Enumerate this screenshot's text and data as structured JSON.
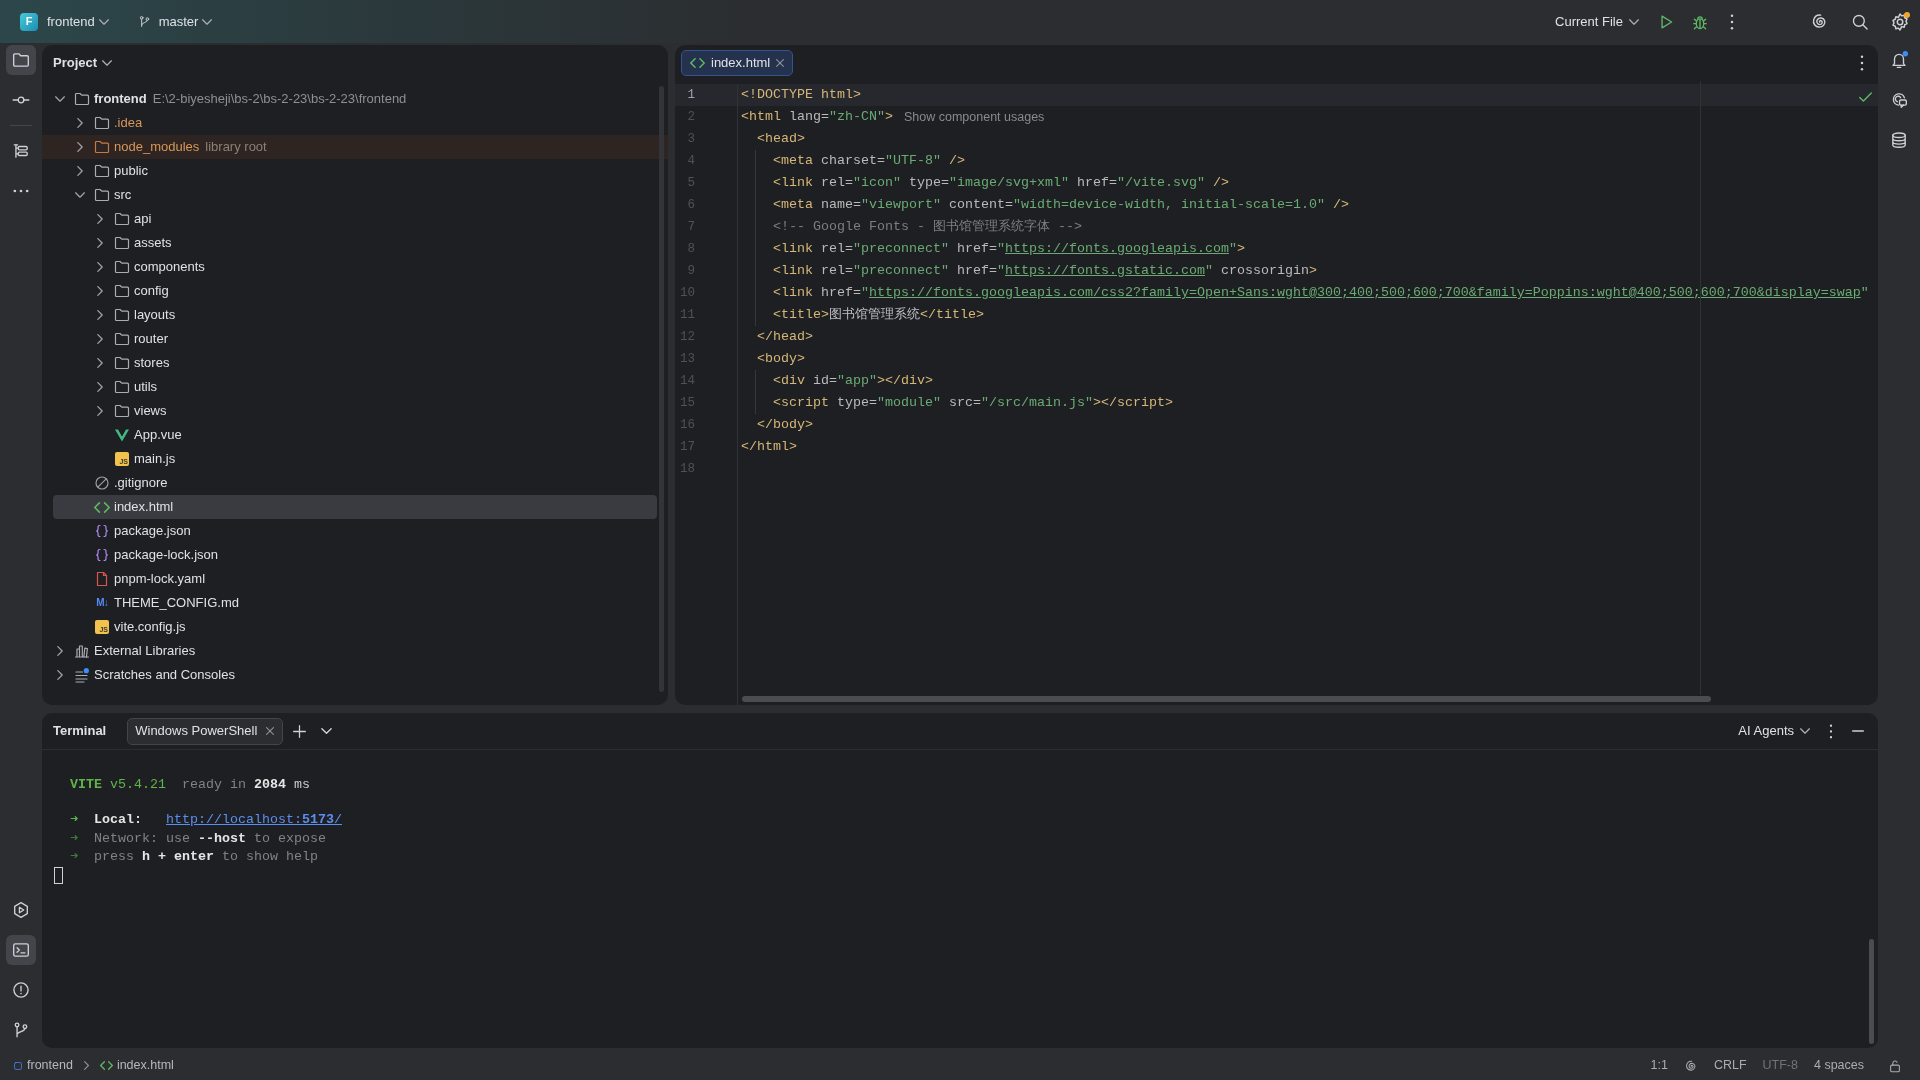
{
  "title_bar": {
    "project": {
      "initial": "F",
      "name": "frontend"
    },
    "branch": "master",
    "run_config": "Current File",
    "run_actions": [
      {
        "kind": "run"
      },
      {
        "kind": "debug"
      },
      {
        "kind": "more"
      }
    ],
    "actions": [
      {
        "kind": "ai",
        "badge": false
      },
      {
        "kind": "search",
        "badge": false
      },
      {
        "kind": "settings",
        "badge": true
      }
    ]
  },
  "left_toolbar": {
    "top_groups": [
      {
        "items": [
          {
            "kind": "project",
            "selected": true
          },
          {
            "kind": "commit",
            "selected": false
          }
        ]
      },
      {
        "items": [
          {
            "kind": "structure",
            "selected": false
          },
          {
            "kind": "more",
            "selected": false
          }
        ]
      }
    ],
    "bottom": [
      {
        "kind": "run",
        "selected": false
      },
      {
        "kind": "terminal",
        "selected": true
      },
      {
        "kind": "problems",
        "selected": false
      },
      {
        "kind": "git",
        "selected": false
      }
    ]
  },
  "right_toolbar": [
    {
      "kind": "notifications",
      "badge": true
    },
    {
      "kind": "ai_chat",
      "badge": false
    },
    {
      "kind": "database",
      "badge": false
    }
  ],
  "project_panel": {
    "title": "Project",
    "tree": [
      {
        "name": "frontend",
        "kind": "root",
        "hint": "E:\\2-biyesheji\\bs-2\\bs-2-23\\bs-2-23\\frontend",
        "expanded": true,
        "selected": false,
        "ignored": false,
        "children": [
          {
            "name": ".idea",
            "kind": "folder",
            "expanded": false,
            "selected": false,
            "ignored": true
          },
          {
            "name": "node_modules",
            "kind": "library",
            "hint": "library root",
            "expanded": false,
            "selected": false,
            "ignored": true
          },
          {
            "name": "public",
            "kind": "folder",
            "expanded": false,
            "selected": false,
            "ignored": false
          },
          {
            "name": "src",
            "kind": "folder",
            "expanded": true,
            "selected": false,
            "ignored": false,
            "children": [
              {
                "name": "api",
                "kind": "folder",
                "expanded": false,
                "selected": false,
                "ignored": false
              },
              {
                "name": "assets",
                "kind": "folder",
                "expanded": false,
                "selected": false,
                "ignored": false
              },
              {
                "name": "components",
                "kind": "folder",
                "expanded": false,
                "selected": false,
                "ignored": false
              },
              {
                "name": "config",
                "kind": "folder",
                "expanded": false,
                "selected": false,
                "ignored": false
              },
              {
                "name": "layouts",
                "kind": "folder",
                "expanded": false,
                "selected": false,
                "ignored": false
              },
              {
                "name": "router",
                "kind": "folder",
                "expanded": false,
                "selected": false,
                "ignored": false
              },
              {
                "name": "stores",
                "kind": "folder",
                "expanded": false,
                "selected": false,
                "ignored": false
              },
              {
                "name": "utils",
                "kind": "folder",
                "expanded": false,
                "selected": false,
                "ignored": false
              },
              {
                "name": "views",
                "kind": "folder",
                "expanded": false,
                "selected": false,
                "ignored": false
              },
              {
                "name": "App.vue",
                "kind": "vue",
                "selected": false,
                "ignored": false
              },
              {
                "name": "main.js",
                "kind": "js",
                "badge": "JS",
                "selected": false,
                "ignored": false
              }
            ]
          },
          {
            "name": ".gitignore",
            "kind": "ignore",
            "selected": false,
            "ignored": false
          },
          {
            "name": "index.html",
            "kind": "html",
            "selected": true,
            "ignored": false
          },
          {
            "name": "package.json",
            "kind": "json",
            "selected": false,
            "ignored": false
          },
          {
            "name": "package-lock.json",
            "kind": "json",
            "selected": false,
            "ignored": false
          },
          {
            "name": "pnpm-lock.yaml",
            "kind": "yaml",
            "selected": false,
            "ignored": false
          },
          {
            "name": "THEME_CONFIG.md",
            "kind": "markdown",
            "badge": "M↓",
            "selected": false,
            "ignored": false
          },
          {
            "name": "vite.config.js",
            "kind": "js",
            "badge": "JS",
            "selected": false,
            "ignored": false
          }
        ]
      },
      {
        "name": "External Libraries",
        "kind": "libraries",
        "expanded": false,
        "selected": false,
        "ignored": false
      },
      {
        "name": "Scratches and Consoles",
        "kind": "scratches",
        "expanded": false,
        "selected": false,
        "ignored": false
      }
    ]
  },
  "editor": {
    "tabs": [
      {
        "label": "index.html",
        "selected": true
      }
    ],
    "lines": [
      {
        "number": "1",
        "current": true,
        "tokens": [
          {
            "kind": "doctype",
            "text": "<!DOCTYPE html>"
          }
        ]
      },
      {
        "number": "2",
        "current": false,
        "tokens": [
          {
            "kind": "tag",
            "text": "<html"
          },
          {
            "kind": "attr",
            "text": " lang="
          },
          {
            "kind": "value",
            "text": "\"zh-CN\""
          },
          {
            "kind": "tag",
            "text": ">"
          }
        ],
        "hint": "Show component usages",
        "children": [
          {
            "number": "3",
            "current": false,
            "tokens": [
              {
                "kind": "tag",
                "text": "<head>"
              }
            ],
            "children": [
              {
                "number": "4",
                "current": false,
                "tokens": [
                  {
                    "kind": "tag",
                    "text": "<meta"
                  },
                  {
                    "kind": "attr",
                    "text": " charset="
                  },
                  {
                    "kind": "value",
                    "text": "\"UTF-8\""
                  },
                  {
                    "kind": "tag",
                    "text": " />"
                  }
                ]
              },
              {
                "number": "5",
                "current": false,
                "tokens": [
                  {
                    "kind": "tag",
                    "text": "<link"
                  },
                  {
                    "kind": "attr",
                    "text": " rel="
                  },
                  {
                    "kind": "value",
                    "text": "\"icon\""
                  },
                  {
                    "kind": "attr",
                    "text": " type="
                  },
                  {
                    "kind": "value",
                    "text": "\"image/svg+xml\""
                  },
                  {
                    "kind": "attr",
                    "text": " href="
                  },
                  {
                    "kind": "value",
                    "text": "\"/vite.svg\""
                  },
                  {
                    "kind": "tag",
                    "text": " />"
                  }
                ]
              },
              {
                "number": "6",
                "current": false,
                "tokens": [
                  {
                    "kind": "tag",
                    "text": "<meta"
                  },
                  {
                    "kind": "attr",
                    "text": " name="
                  },
                  {
                    "kind": "value",
                    "text": "\"viewport\""
                  },
                  {
                    "kind": "attr",
                    "text": " content="
                  },
                  {
                    "kind": "value",
                    "text": "\"width=device-width, initial-scale=1.0\""
                  },
                  {
                    "kind": "tag",
                    "text": " />"
                  }
                ]
              },
              {
                "number": "7",
                "current": false,
                "tokens": [
                  {
                    "kind": "comment",
                    "text": "<!-- Google Fonts - 图书馆管理系统字体 -->"
                  }
                ]
              },
              {
                "number": "8",
                "current": false,
                "tokens": [
                  {
                    "kind": "tag",
                    "text": "<link"
                  },
                  {
                    "kind": "attr",
                    "text": " rel="
                  },
                  {
                    "kind": "value",
                    "text": "\"preconnect\""
                  },
                  {
                    "kind": "attr",
                    "text": " href="
                  },
                  {
                    "kind": "value",
                    "text": "\""
                  },
                  {
                    "kind": "link",
                    "text": "https://fonts.googleapis.com"
                  },
                  {
                    "kind": "value",
                    "text": "\""
                  },
                  {
                    "kind": "tag",
                    "text": ">"
                  }
                ]
              },
              {
                "number": "9",
                "current": false,
                "tokens": [
                  {
                    "kind": "tag",
                    "text": "<link"
                  },
                  {
                    "kind": "attr",
                    "text": " rel="
                  },
                  {
                    "kind": "value",
                    "text": "\"preconnect\""
                  },
                  {
                    "kind": "attr",
                    "text": " href="
                  },
                  {
                    "kind": "value",
                    "text": "\""
                  },
                  {
                    "kind": "link",
                    "text": "https://fonts.gstatic.com"
                  },
                  {
                    "kind": "value",
                    "text": "\""
                  },
                  {
                    "kind": "attr",
                    "text": " crossorigin"
                  },
                  {
                    "kind": "tag",
                    "text": ">"
                  }
                ]
              },
              {
                "number": "10",
                "current": false,
                "tokens": [
                  {
                    "kind": "tag",
                    "text": "<link"
                  },
                  {
                    "kind": "attr",
                    "text": " href="
                  },
                  {
                    "kind": "value",
                    "text": "\""
                  },
                  {
                    "kind": "link",
                    "text": "https://fonts.googleapis.com/css2?family=Open+Sans:wght@300;400;500;600;700&family=Poppins:wght@400;500;600;700&display=swap"
                  },
                  {
                    "kind": "value",
                    "text": "\""
                  }
                ]
              },
              {
                "number": "11",
                "current": false,
                "tokens": [
                  {
                    "kind": "tag",
                    "text": "<title>"
                  },
                  {
                    "kind": "text",
                    "text": "图书馆管理系统"
                  },
                  {
                    "kind": "tag",
                    "text": "</title>"
                  }
                ]
              }
            ]
          },
          {
            "number": "12",
            "current": false,
            "tokens": [
              {
                "kind": "tag",
                "text": "</head>"
              }
            ]
          },
          {
            "number": "13",
            "current": false,
            "tokens": [
              {
                "kind": "tag",
                "text": "<body>"
              }
            ],
            "children": [
              {
                "number": "14",
                "current": false,
                "tokens": [
                  {
                    "kind": "tag",
                    "text": "<div"
                  },
                  {
                    "kind": "attr",
                    "text": " id="
                  },
                  {
                    "kind": "value",
                    "text": "\"app\""
                  },
                  {
                    "kind": "tag",
                    "text": "></div>"
                  }
                ]
              },
              {
                "number": "15",
                "current": false,
                "tokens": [
                  {
                    "kind": "tag",
                    "text": "<script"
                  },
                  {
                    "kind": "attr",
                    "text": " type="
                  },
                  {
                    "kind": "value",
                    "text": "\"module\""
                  },
                  {
                    "kind": "attr",
                    "text": " src="
                  },
                  {
                    "kind": "value",
                    "text": "\"/src/main.js\""
                  },
                  {
                    "kind": "tag",
                    "text": "></script>"
                  }
                ]
              }
            ]
          },
          {
            "number": "16",
            "current": false,
            "tokens": [
              {
                "kind": "tag",
                "text": "</body>"
              }
            ]
          }
        ]
      },
      {
        "number": "17",
        "current": false,
        "tokens": [
          {
            "kind": "tag",
            "text": "</html>"
          }
        ]
      },
      {
        "number": "18",
        "current": false
      }
    ]
  },
  "terminal": {
    "title": "Terminal",
    "tabs": [
      {
        "label": "Windows PowerShell",
        "selected": true
      }
    ],
    "agents": "AI Agents",
    "blocks": [
      {
        "lines": [
          {
            "tokens": [
              {
                "kind": "brand",
                "text": "VITE"
              },
              {
                "kind": "version",
                "text": " v5.4.21"
              },
              {
                "kind": "dim",
                "text": "  ready in "
              },
              {
                "kind": "bold",
                "text": "2084"
              },
              {
                "kind": "plain",
                "text": " ms"
              }
            ]
          }
        ]
      },
      {
        "lines": [
          {
            "tokens": [
              {
                "kind": "arrow",
                "text": "➜"
              },
              {
                "kind": "label",
                "text": "  Local:   "
              },
              {
                "kind": "link",
                "text": "http://localhost:**5173**/"
              }
            ]
          },
          {
            "tokens": [
              {
                "kind": "arrow_dim",
                "text": "➜"
              },
              {
                "kind": "dim",
                "text": "  Network: use "
              },
              {
                "kind": "bold",
                "text": "--host"
              },
              {
                "kind": "dim",
                "text": " to expose"
              }
            ]
          },
          {
            "tokens": [
              {
                "kind": "arrow_dim",
                "text": "➜"
              },
              {
                "kind": "dim",
                "text": "  press "
              },
              {
                "kind": "bold",
                "text": "h + enter"
              },
              {
                "kind": "dim",
                "text": " to show help"
              }
            ]
          }
        ]
      }
    ]
  },
  "status_bar": {
    "breadcrumbs": [
      {
        "kind": "module",
        "label": "frontend"
      },
      {
        "kind": "html",
        "label": "index.html"
      }
    ],
    "items": [
      {
        "kind": "text",
        "label": "1:1",
        "disabled": false
      },
      {
        "kind": "ai",
        "disabled": false
      },
      {
        "kind": "text",
        "label": "CRLF",
        "disabled": false
      },
      {
        "kind": "text",
        "label": "UTF-8",
        "disabled": true
      },
      {
        "kind": "text",
        "label": "4 spaces",
        "disabled": false
      },
      {
        "kind": "lock",
        "disabled": false
      }
    ]
  }
}
